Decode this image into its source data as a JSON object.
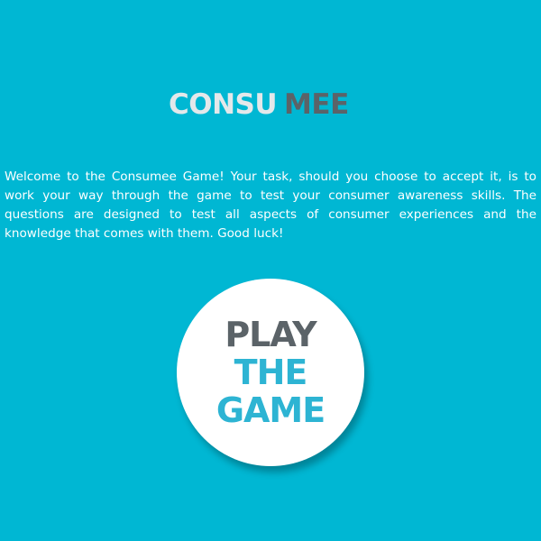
{
  "logo": {
    "part_a": "CONSU",
    "part_b": "MEE"
  },
  "intro": {
    "text": "Welcome to the Consumee Game! Your task, should you choose to accept it, is to work your way through the game to test your consumer awareness skills. The questions are designed to test all aspects of consumer experiences and the knowledge that comes with them. Good luck!"
  },
  "play_button": {
    "line_1": "PLAY",
    "line_2": "THE",
    "line_3": "GAME"
  },
  "colors": {
    "background": "#00b7d3",
    "logo_light": "#e4e8ea",
    "logo_dark": "#5b6368",
    "button_face": "#ffffff",
    "button_accent": "#2db4d3"
  }
}
